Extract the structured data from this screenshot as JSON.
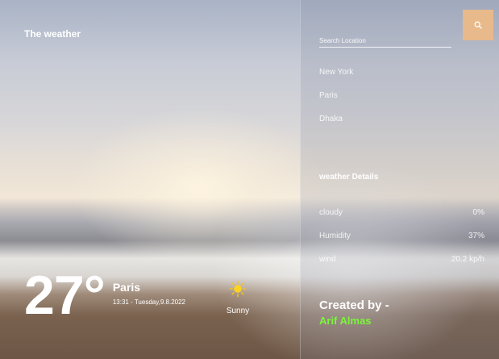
{
  "app": {
    "title": "The weather"
  },
  "current": {
    "temperature": "27°",
    "city": "Paris",
    "datetime": "13:31 - Tuesday,9.8.2022",
    "condition": "Sunny",
    "condition_icon": "sun-icon"
  },
  "search": {
    "placeholder": "Search Location",
    "button_icon": "search-icon"
  },
  "cities": [
    "New York",
    "Paris",
    "Dhaka"
  ],
  "details": {
    "title": "weather Details",
    "rows": [
      {
        "label": "cloudy",
        "value": "0%"
      },
      {
        "label": "Humidity",
        "value": "37%"
      },
      {
        "label": "wind",
        "value": "20.2 kp/h"
      }
    ]
  },
  "credit": {
    "label": "Created by -",
    "name": "Arif Almas"
  },
  "colors": {
    "accent": "#e8b98a",
    "credit_name": "#7cf53a",
    "text": "#ffffff"
  }
}
